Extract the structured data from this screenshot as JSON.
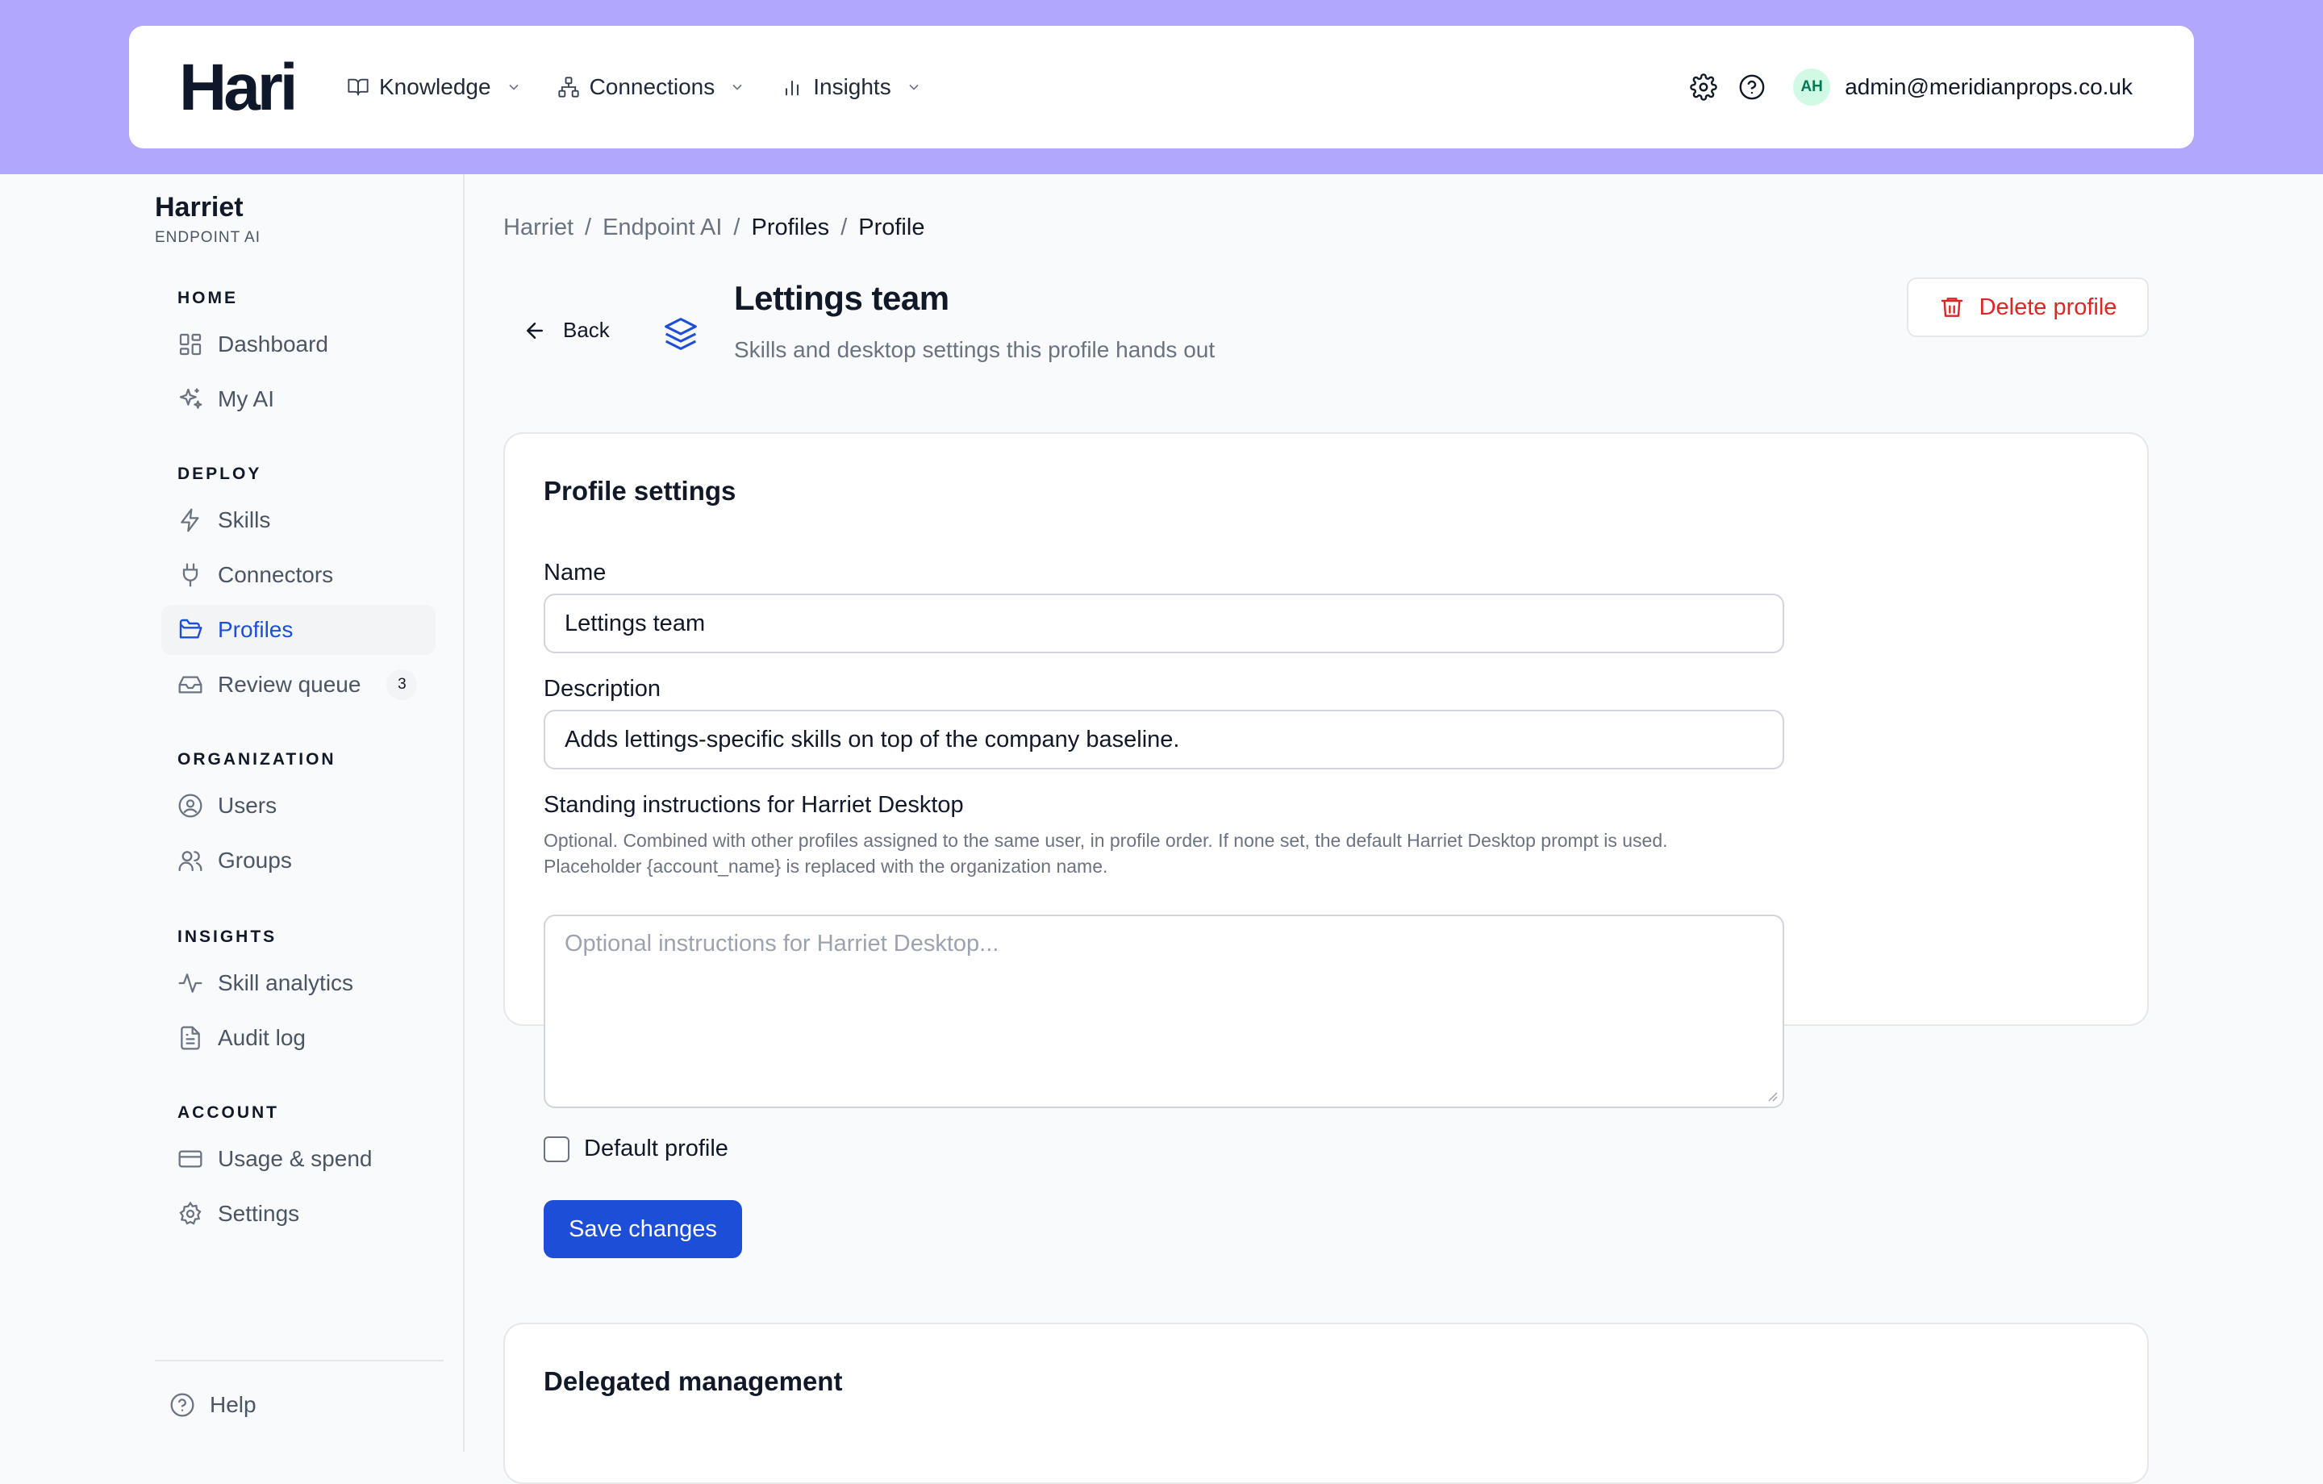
{
  "header": {
    "logo": "Hari",
    "nav": [
      {
        "label": "Knowledge",
        "icon": "book-icon"
      },
      {
        "label": "Connections",
        "icon": "network-icon"
      },
      {
        "label": "Insights",
        "icon": "bar-chart-icon"
      }
    ],
    "avatar_initials": "AH",
    "user_email": "admin@meridianprops.co.uk"
  },
  "sidebar": {
    "org_name": "Harriet",
    "org_sub": "ENDPOINT AI",
    "sections": {
      "home": "HOME",
      "deploy": "DEPLOY",
      "organization": "ORGANIZATION",
      "insights": "INSIGHTS",
      "account": "ACCOUNT"
    },
    "items": {
      "dashboard": "Dashboard",
      "my_ai": "My AI",
      "skills": "Skills",
      "connectors": "Connectors",
      "profiles": "Profiles",
      "review_queue": "Review queue",
      "review_queue_count": "3",
      "users": "Users",
      "groups": "Groups",
      "skill_analytics": "Skill analytics",
      "audit_log": "Audit log",
      "usage_spend": "Usage & spend",
      "settings": "Settings"
    },
    "help": "Help"
  },
  "breadcrumb": [
    "Harriet",
    "Endpoint AI",
    "Profiles",
    "Profile"
  ],
  "page": {
    "back_label": "Back",
    "title": "Lettings team",
    "subtitle": "Skills and desktop settings this profile hands out",
    "delete_label": "Delete profile"
  },
  "settings_card": {
    "title": "Profile settings",
    "name_label": "Name",
    "name_value": "Lettings team",
    "description_label": "Description",
    "description_value": "Adds lettings-specific skills on top of the company baseline.",
    "instructions_label": "Standing instructions for Harriet Desktop",
    "instructions_hint_1": "Optional. Combined with other profiles assigned to the same user, in profile order. If none set, the default Harriet Desktop prompt is used.",
    "instructions_hint_2": "Placeholder {account_name} is replaced with the organization name.",
    "instructions_placeholder": "Optional instructions for Harriet Desktop...",
    "default_label": "Default profile",
    "default_checked": false,
    "save_label": "Save changes"
  },
  "delegated_card": {
    "title": "Delegated management"
  },
  "colors": {
    "accent": "#1d4ed8",
    "banner": "#b1a8fb",
    "danger": "#dc2626"
  }
}
